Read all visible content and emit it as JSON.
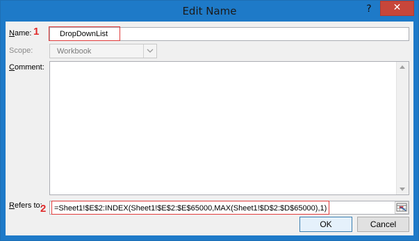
{
  "dialog": {
    "title": "Edit Name",
    "help": "?",
    "close": "✕"
  },
  "form": {
    "name_label_access": "N",
    "name_label_rest": "ame:",
    "name_value": "DropDownList",
    "scope_label": "Scope:",
    "scope_value": "Workbook",
    "comment_label_access": "C",
    "comment_label_rest": "omment:",
    "comment_value": "",
    "refers_label_access": "R",
    "refers_label_rest": "efers to:",
    "refers_value": "=Sheet1!$E$2:INDEX(Sheet1!$E$2:$E$65000,MAX(Sheet1!$D$2:$D$65000),1)"
  },
  "annotations": {
    "marker_1": "1",
    "marker_2": "2",
    "highlight_color": "#e03a3a"
  },
  "buttons": {
    "ok": "OK",
    "cancel": "Cancel"
  },
  "icons": {
    "help": "question-mark-icon",
    "close": "close-icon",
    "dropdown": "chevron-down-icon",
    "collapse": "range-select-icon"
  }
}
